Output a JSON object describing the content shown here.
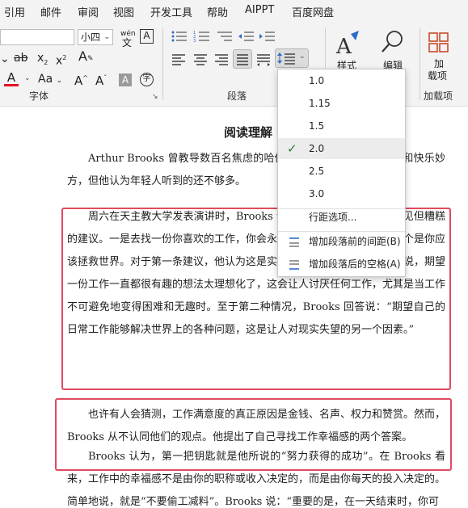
{
  "tabs": [
    "引用",
    "邮件",
    "审阅",
    "视图",
    "开发工具",
    "帮助",
    "AIPPT",
    "百度网盘"
  ],
  "font": {
    "size_value": "小四",
    "phonetic_label": "wén",
    "group_label": "字体"
  },
  "paragraph": {
    "group_label": "段落"
  },
  "styles": {
    "label": "样式"
  },
  "editing": {
    "label": "编辑"
  },
  "addins": {
    "button_label_1": "加",
    "button_label_2": "载项",
    "group_label": "加载项"
  },
  "colors": {
    "accent": "#e04a5f",
    "font_color_bar": "#e81123"
  },
  "document": {
    "title": "阅读理解",
    "p1": "Arthur Brooks 曾教导数百名焦虑的哈佛学生寻找职业上获得幸福和快乐妙方，但他认为年轻人听到的还不够多。",
    "p2": "周六在天主教大学发表演讲时，Brooks 说，年轻人收到的两个最常见但糟糕的建议。一是去找一份你喜欢的工作，你会永远在工作中获得满足。另一个是你应该拯救世界。对于第一条建议，他认为这是实现幸福的错误方法。他解释说，期望一份工作一直都很有趣的想法太理想化了，这会让人讨厌任何工作，尤其是当工作不可避免地变得困难和无趣时。至于第二种情况，Brooks 回答说：“期望自己的日常工作能够解决世界上的各种问题，这是让人对现实失望的另一个因素。”",
    "p3": "也许有人会猜测，工作满意度的真正原因是金钱、名声、权力和赞赏。然而，Brooks 从不认同他们的观点。他提出了自己寻找工作幸福感的两个答案。",
    "p4": "Brooks 认为，第一把钥匙就是他所说的“努力获得的成功”。在 Brooks 看来，工作中的幸福感不是由你的职称或收入决定的，而是由你每天的投入决定的。简单地说，就是“不要偷工减料”。Brooks 说：“重要的是，在一天结束时，你可"
  },
  "line_spacing_menu": {
    "options": [
      "1.0",
      "1.15",
      "1.5",
      "2.0",
      "2.5",
      "3.0"
    ],
    "selected": "2.0",
    "more_options": "行距选项...",
    "add_before": "增加段落前的间距(B)",
    "add_after": "增加段落后的空格(A)"
  }
}
